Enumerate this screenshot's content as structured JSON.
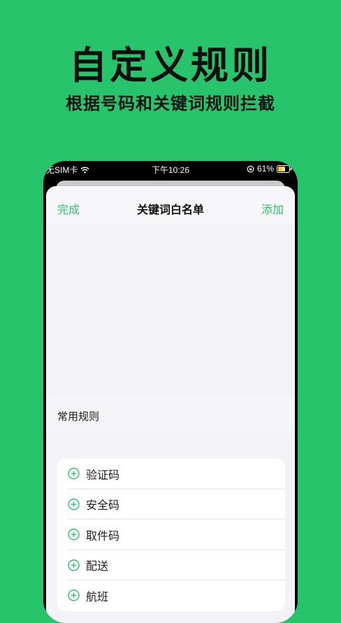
{
  "hero": {
    "title": "自定义规则",
    "subtitle": "根据号码和关键词规则拦截"
  },
  "status_bar": {
    "carrier": "无SIM卡",
    "time": "下午10:26",
    "battery": "61%"
  },
  "navbar": {
    "done_label": "完成",
    "title": "关键词白名单",
    "add_label": "添加"
  },
  "section": {
    "header": "常用规则"
  },
  "rules": [
    {
      "label": "验证码"
    },
    {
      "label": "安全码"
    },
    {
      "label": "取件码"
    },
    {
      "label": "配送"
    },
    {
      "label": "航班"
    }
  ],
  "colors": {
    "background": "#27c46b",
    "accent": "#2ec06a"
  }
}
